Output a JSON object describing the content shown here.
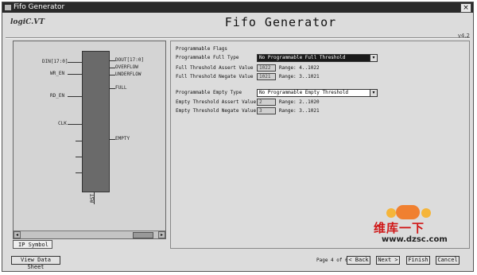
{
  "window": {
    "title": "Fifo Generator",
    "close_glyph": "×"
  },
  "header": {
    "logo": "logiC.VT",
    "title": "Fifo Generator",
    "version": "v4.2"
  },
  "symbol_pane": {
    "left_pins": [
      "DIN[17:0]",
      "WR_EN",
      "RD_EN",
      "CLK"
    ],
    "right_pins": [
      "DOUT[17:0]",
      "OVERFLOW",
      "UNDERFLOW",
      "FULL",
      "EMPTY"
    ],
    "bottom_pin": "RST",
    "tab_label": "IP Symbol"
  },
  "settings": {
    "group_title": "Programmable Flags",
    "full_type_label": "Programmable Full Type",
    "full_type_value": "No Programmable Full Threshold",
    "full_assert_label": "Full Threshold Assert Value",
    "full_assert_value": "1022",
    "full_assert_range": "Range: 4..1022",
    "full_negate_label": "Full Threshold Negate Value",
    "full_negate_value": "1021",
    "full_negate_range": "Range: 3..1021",
    "empty_type_label": "Programmable Empty Type",
    "empty_type_value": "No Programmable Empty Threshold",
    "empty_assert_label": "Empty Threshold Assert Value",
    "empty_assert_value": "2",
    "empty_assert_range": "Range: 2..1020",
    "empty_negate_label": "Empty Threshold Negate Value",
    "empty_negate_value": "3",
    "empty_negate_range": "Range: 3..1021"
  },
  "footer": {
    "view_data_sheet": "View Data Sheet",
    "page_indicator": "Page 4 of 6",
    "back": "< Back",
    "next": "Next >",
    "finish": "Finish",
    "cancel": "Cancel"
  },
  "watermark": {
    "chinese": "维库一下",
    "url": "www.dzsc.com"
  },
  "colors": {
    "titlebar": "#2a2a2a",
    "symbol_block": "#6a6a6a",
    "watermark_red": "#d01616",
    "highlight": "#1a1a1a"
  }
}
